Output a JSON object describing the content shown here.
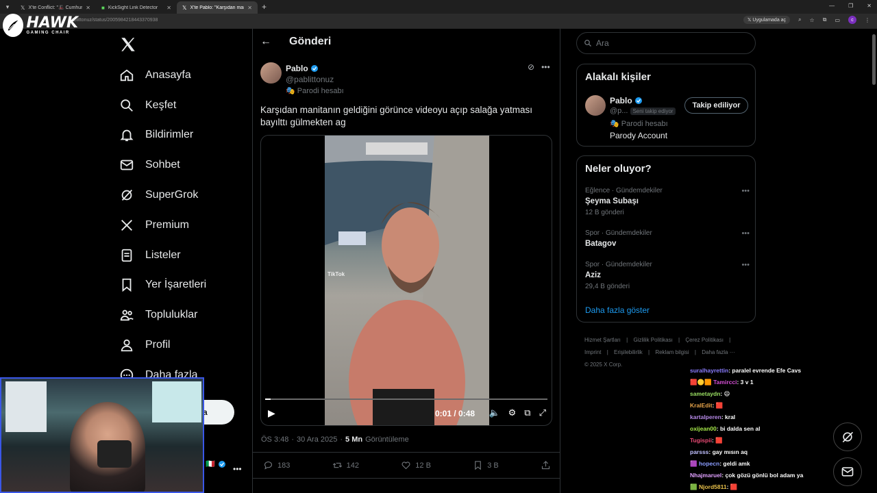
{
  "browser": {
    "tabs": [
      {
        "label": "X'te Conflict: \"🎩 Cumhurbaşk",
        "active": false
      },
      {
        "label": "KickSight Link Detector",
        "active": false
      },
      {
        "label": "X'te Pablo: \"Karşıdan maniten",
        "active": true
      }
    ],
    "url": "pablittonuz/status/2005984218443370938",
    "app_pill": "Uygulamada aç"
  },
  "overlay": {
    "brand": "HAWK",
    "brand_sub": "GAMING CHAIR"
  },
  "nav": {
    "items": [
      {
        "label": "Anasayfa",
        "icon": "home-icon"
      },
      {
        "label": "Keşfet",
        "icon": "search-icon"
      },
      {
        "label": "Bildirimler",
        "icon": "bell-icon"
      },
      {
        "label": "Sohbet",
        "icon": "mail-icon"
      },
      {
        "label": "SuperGrok",
        "icon": "grok-icon"
      },
      {
        "label": "Premium",
        "icon": "x-icon"
      },
      {
        "label": "Listeler",
        "icon": "list-icon"
      },
      {
        "label": "Yer İşaretleri",
        "icon": "bookmark-icon"
      },
      {
        "label": "Topluluklar",
        "icon": "people-icon"
      },
      {
        "label": "Profil",
        "icon": "person-icon"
      },
      {
        "label": "Daha fazla",
        "icon": "more-circle-icon"
      }
    ],
    "post_button_visible_fragment": "a"
  },
  "header": {
    "title": "Gönderi"
  },
  "post": {
    "author_name": "Pablo",
    "author_handle": "@pablittonuz",
    "author_label": "Parodi hesabı",
    "text": "Karşıdan manitanın geldiğini görünce videoyu açıp salağa yatması bayılttı gülmekten ag",
    "video": {
      "time": "0:01 / 0:48",
      "progress": 0.02,
      "watermark": "TikTok"
    },
    "time": "ÖS 3:48",
    "date": "30 Ara 2025",
    "views_count": "5 Mn",
    "views_label": "Görüntüleme",
    "stats": {
      "replies": "183",
      "reposts": "142",
      "likes": "12 B",
      "bookmarks": "3 B"
    }
  },
  "right": {
    "search_placeholder": "Ara",
    "related_title": "Alakalı kişiler",
    "related": {
      "name": "Pablo",
      "handle": "@p...",
      "chip": "Seni takip ediyor",
      "label": "Parodi hesabı",
      "bio": "Parody Account",
      "button": "Takip ediliyor"
    },
    "trends_title": "Neler oluyor?",
    "trends": [
      {
        "category": "Eğlence · Gündemdekiler",
        "name": "Şeyma Subaşı",
        "count": "12 B gönderi"
      },
      {
        "category": "Spor · Gündemdekiler",
        "name": "Batagov",
        "count": ""
      },
      {
        "category": "Spor · Gündemdekiler",
        "name": "Aziz",
        "count": "29,4 B gönderi"
      }
    ],
    "show_more": "Daha fazla göster",
    "footer": [
      "Hizmet Şartları",
      "|",
      "Gizlilik Politikası",
      "|",
      "Çerez Politikası",
      "|",
      "Imprint",
      "|",
      "Erişilebilirlik",
      "|",
      "Reklam bilgisi",
      "|",
      "Daha fazla ···",
      "© 2025 X Corp."
    ]
  },
  "chat": [
    {
      "user": "suralhayrettin",
      "color": "#8a7cff",
      "msg": ": paralel evrende Efe Cavs"
    },
    {
      "user": "Tamircci",
      "color": "#d64fd6",
      "msg": ": 3 v 1"
    },
    {
      "user": "sametaydn",
      "color": "#9be063",
      "msg": ": 😄"
    },
    {
      "user": "KralEdit",
      "color": "#e8a44a",
      "msg": ": 🟥"
    },
    {
      "user": "kartalperen",
      "color": "#b78ae8",
      "msg": ": kral"
    },
    {
      "user": "oxijean00",
      "color": "#a6e84a",
      "msg": ": bi dalda sen al"
    },
    {
      "user": "Tugispii",
      "color": "#e84a74",
      "msg": ": 🟥"
    },
    {
      "user": "parsss",
      "color": "#c0c0ff",
      "msg": ": gay mısın aq"
    },
    {
      "user": "hopecn",
      "color": "#8a9cff",
      "msg": ": geldi amk"
    },
    {
      "user": "Nhajmaruel",
      "color": "#e0a0ff",
      "msg": ": çok gözü gönlü bol adam ya"
    },
    {
      "user": "Njord5811",
      "color": "#e8c04a",
      "msg": ": 🟥"
    }
  ],
  "colors": {
    "accent": "#1d9bf0",
    "border": "#2f3336",
    "muted": "#71767b",
    "webcam_border": "#3a57e8"
  }
}
